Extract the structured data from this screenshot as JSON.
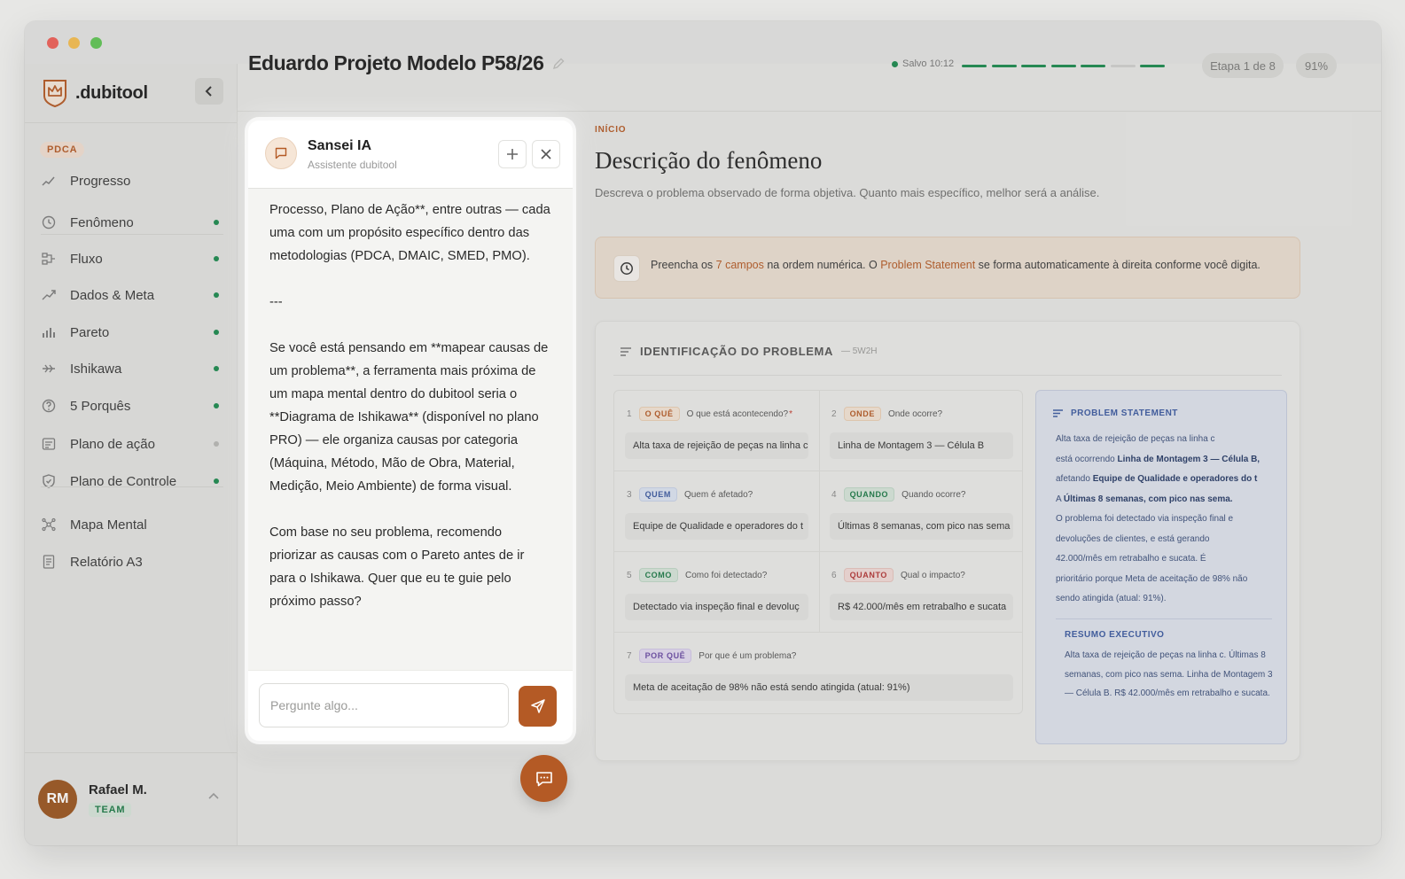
{
  "app": {
    "brand": ".dubitool"
  },
  "sidebar": {
    "section_tag": "PDCA",
    "items": [
      {
        "label": "Progresso",
        "icon": "progress-icon",
        "status": "none"
      },
      {
        "label": "Fenômeno",
        "icon": "clock-icon",
        "status": "done"
      },
      {
        "label": "Fluxo",
        "icon": "flow-icon",
        "status": "done"
      },
      {
        "label": "Dados & Meta",
        "icon": "trend-icon",
        "status": "done"
      },
      {
        "label": "Pareto",
        "icon": "bar-chart-icon",
        "status": "done"
      },
      {
        "label": "Ishikawa",
        "icon": "fishbone-icon",
        "status": "done"
      },
      {
        "label": "5 Porquês",
        "icon": "question-icon",
        "status": "done"
      },
      {
        "label": "Plano de ação",
        "icon": "list-icon",
        "status": "pending"
      },
      {
        "label": "Plano de Controle",
        "icon": "shield-icon",
        "status": "done"
      },
      {
        "label": "Mapa Mental",
        "icon": "mind-map-icon",
        "status": "none"
      },
      {
        "label": "Relatório A3",
        "icon": "document-icon",
        "status": "none"
      }
    ],
    "user": {
      "initials": "RM",
      "name": "Rafael M.",
      "plan": "TEAM"
    }
  },
  "header": {
    "project_title": "Eduardo Projeto Modelo P58/26",
    "saved": "Salvo 10:12",
    "step": "Etapa 1 de 8",
    "completion": "91%",
    "progress_segments": [
      1,
      1,
      1,
      1,
      1,
      0,
      1
    ]
  },
  "content": {
    "breadcrumb": "INÍCIO",
    "title": "Descrição do fenômeno",
    "description": "Descreva o problema observado de forma objetiva. Quanto mais específico, melhor será a análise.",
    "info": {
      "t1": "Preencha os ",
      "h1": "7 campos",
      "t2": " na ordem numérica. O ",
      "h2": "Problem Statement",
      "t3": " se forma automaticamente à direita conforme você digita."
    },
    "card": {
      "title": "IDENTIFICAÇÃO DO PROBLEMA",
      "subtitle": "— 5W2H",
      "fields": [
        {
          "num": "1",
          "tag": "O QUÊ",
          "color": "orange",
          "question": "O que está acontecendo?",
          "required": "*",
          "value": "Alta taxa de rejeição de peças na linha c"
        },
        {
          "num": "2",
          "tag": "ONDE",
          "color": "orange",
          "question": "Onde ocorre?",
          "value": "Linha de Montagem 3 — Célula B"
        },
        {
          "num": "3",
          "tag": "QUEM",
          "color": "blue",
          "question": "Quem é afetado?",
          "value": "Equipe de Qualidade e operadores do t"
        },
        {
          "num": "4",
          "tag": "QUANDO",
          "color": "green",
          "question": "Quando ocorre?",
          "value": "Últimas 8 semanas, com pico nas sema"
        },
        {
          "num": "5",
          "tag": "COMO",
          "color": "green",
          "question": "Como foi detectado?",
          "value": "Detectado via inspeção final e devoluç"
        },
        {
          "num": "6",
          "tag": "QUANTO",
          "color": "red",
          "question": "Qual o impacto?",
          "value": "R$ 42.000/mês em retrabalho e sucata"
        },
        {
          "num": "7",
          "tag": "POR QUÊ",
          "color": "purple",
          "question": "Por que é um problema?",
          "value": "Meta de aceitação de 98% não está sendo atingida (atual: 91%)"
        }
      ]
    },
    "problem_statement": {
      "title": "PROBLEM STATEMENT",
      "lines": [
        [
          "Alta taxa de rejeição de peças na linha c",
          ""
        ],
        [
          "está ocorrendo ",
          "Linha de Montagem 3 — Célula B,"
        ],
        [
          "afetando ",
          "Equipe de Qualidade e operadores do t"
        ],
        [
          "A ",
          "Últimas 8 semanas, com pico nas sema."
        ],
        [
          "O problema foi detectado via inspeção final e",
          ""
        ],
        [
          "devoluções de clientes, e está gerando",
          ""
        ],
        [
          "42.000/mês em retrabalho e sucata. É",
          ""
        ],
        [
          "prioritário porque Meta de aceitação de 98% não",
          ""
        ],
        [
          "sendo atingida (atual: 91%).",
          ""
        ]
      ],
      "summary_title": "RESUMO EXECUTIVO",
      "summary": "Alta taxa de rejeição de peças na linha c. Últimas 8 semanas, com pico nas sema. Linha de Montagem 3 — Célula B. R$ 42.000/mês em retrabalho e sucata."
    }
  },
  "chat": {
    "name": "Sansei IA",
    "subtitle": "Assistente dubitool",
    "messages": [
      "Processo, Plano de Ação**, entre outras — cada uma com um propósito específico dentro das metodologias (PDCA, DMAIC, SMED, PMO).",
      "---",
      "Se você está pensando em **mapear causas de um problema**, a ferramenta mais próxima de um mapa mental dentro do dubitool seria o **Diagrama de Ishikawa** (disponível no plano PRO) — ele organiza causas por categoria (Máquina, Método, Mão de Obra, Material, Medição, Meio Ambiente) de forma visual.",
      "Com base no seu problema, recomendo priorizar as causas com o Pareto antes de ir para o Ishikawa. Quer que eu te guie pelo próximo passo?"
    ],
    "input_placeholder": "Pergunte algo...",
    "colors": {
      "accent": "#b45a25",
      "success": "#1c8a4e",
      "statement": "#3b5aa0"
    }
  }
}
